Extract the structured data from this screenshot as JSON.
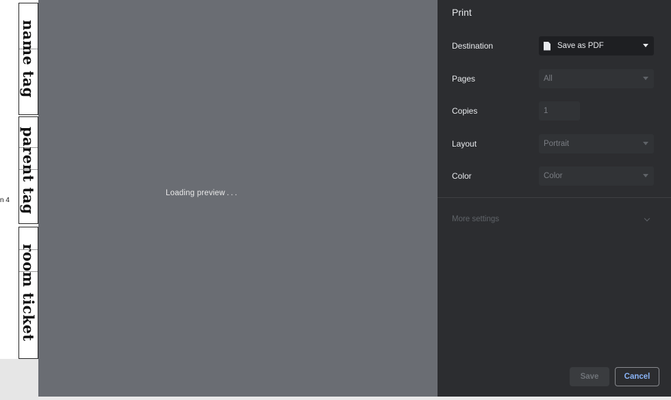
{
  "document": {
    "labels": [
      "name tag",
      "parent tag",
      "room ticket"
    ],
    "fragment": "       4"
  },
  "preview": {
    "loading_text": "Loading preview . . ."
  },
  "panel": {
    "title": "Print",
    "destination": {
      "label": "Destination",
      "value": "Save as PDF",
      "icon": "document-icon"
    },
    "pages": {
      "label": "Pages",
      "value": "All"
    },
    "copies": {
      "label": "Copies",
      "value": "1"
    },
    "layout": {
      "label": "Layout",
      "value": "Portrait"
    },
    "color": {
      "label": "Color",
      "value": "Color"
    },
    "more_settings": "More settings",
    "save_label": "Save",
    "cancel_label": "Cancel"
  },
  "colors": {
    "panel_bg": "#2c2d30",
    "preview_bg": "#6a6d73",
    "link_blue": "#8ab4f8"
  }
}
